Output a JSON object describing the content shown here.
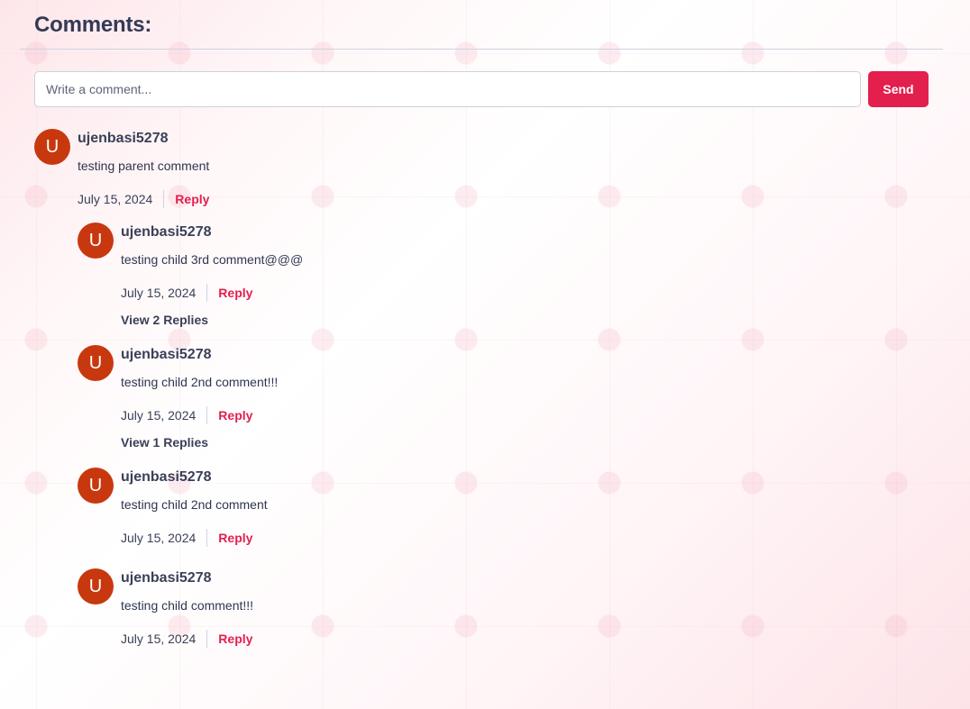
{
  "header": {
    "title": "Comments:"
  },
  "composer": {
    "placeholder": "Write a comment...",
    "value": "",
    "send_label": "Send"
  },
  "reply_label": "Reply",
  "parent": {
    "avatar_letter": "U",
    "username": "ujenbasi5278",
    "text": "testing parent comment",
    "date": "July 15, 2024"
  },
  "children": [
    {
      "avatar_letter": "U",
      "username": "ujenbasi5278",
      "text": "testing child 3rd comment@@@",
      "date": "July 15, 2024",
      "view_replies": "View 2 Replies"
    },
    {
      "avatar_letter": "U",
      "username": "ujenbasi5278",
      "text": "testing child 2nd comment!!!",
      "date": "July 15, 2024",
      "view_replies": "View 1 Replies"
    },
    {
      "avatar_letter": "U",
      "username": "ujenbasi5278",
      "text": "testing child 2nd comment",
      "date": "July 15, 2024"
    },
    {
      "avatar_letter": "U",
      "username": "ujenbasi5278",
      "text": "testing child comment!!!",
      "date": "July 15, 2024"
    }
  ],
  "colors": {
    "accent": "#e31f4e",
    "avatar": "#c8380f",
    "text": "#2f3650"
  }
}
